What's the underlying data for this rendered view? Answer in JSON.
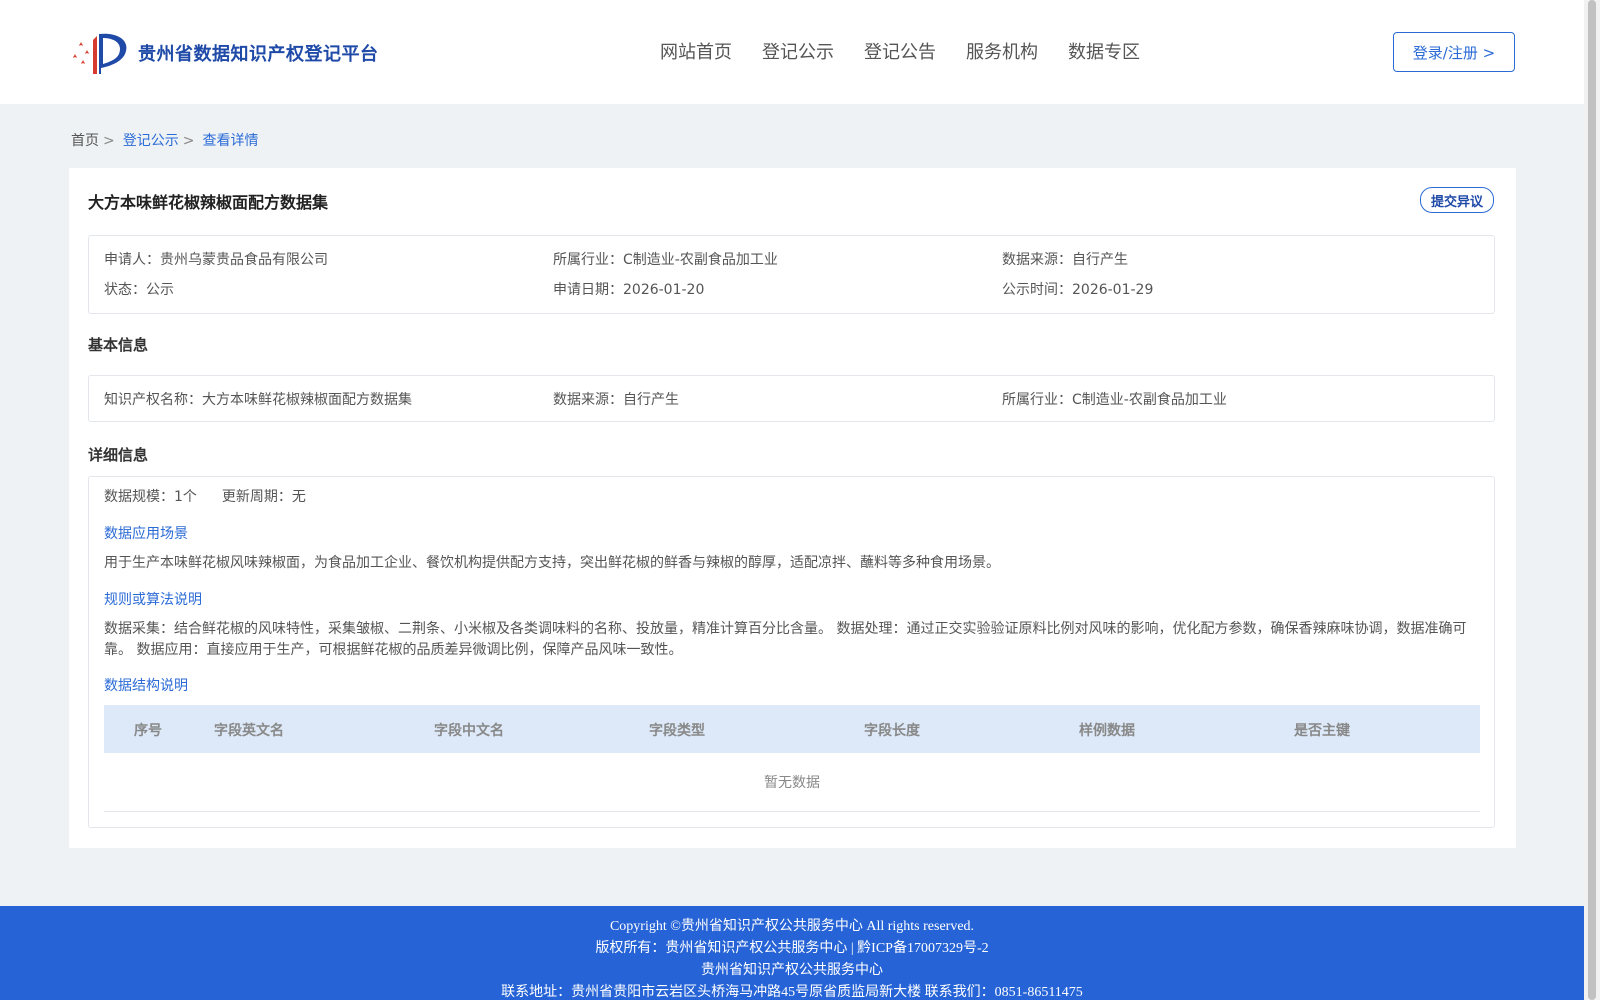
{
  "header": {
    "site_title": "贵州省数据知识产权登记平台",
    "logo_icon": "ip-platform-logo-icon",
    "nav": [
      "网站首页",
      "登记公示",
      "登记公告",
      "服务机构",
      "数据专区"
    ],
    "login_label": "登录/注册 >"
  },
  "breadcrumb": {
    "home": "首页",
    "sep": ">",
    "level2": "登记公示",
    "current": "查看详情"
  },
  "detail": {
    "title": "大方本味鲜花椒辣椒面配方数据集",
    "objection_label": "提交异议",
    "summary": {
      "applicant_label": "申请人：",
      "applicant": "贵州乌蒙贵品食品有限公司",
      "industry_label": "所属行业：",
      "industry": "C制造业-农副食品加工业",
      "source_label": "数据来源：",
      "source": "自行产生",
      "status_label": "状态：",
      "status": "公示",
      "apply_date_label": "申请日期：",
      "apply_date": "2026-01-20",
      "publish_time_label": "公示时间：",
      "publish_time": "2026-01-29"
    },
    "basic_title": "基本信息",
    "basic": {
      "ip_name_label": "知识产权名称：",
      "ip_name": "大方本味鲜花椒辣椒面配方数据集",
      "source_label": "数据来源：",
      "source": "自行产生",
      "industry_label": "所属行业：",
      "industry": "C制造业-农副食品加工业"
    },
    "detail_title": "详细信息",
    "scale_label": "数据规模：",
    "scale": "1个",
    "update_label": "更新周期：",
    "update": "无",
    "scene_title": "数据应用场景",
    "scene_text": "用于生产本味鲜花椒风味辣椒面，为食品加工企业、餐饮机构提供配方支持，突出鲜花椒的鲜香与辣椒的醇厚，适配凉拌、蘸料等多种食用场景。",
    "rule_title": "规则或算法说明",
    "rule_text": "数据采集：结合鲜花椒的风味特性，采集皱椒、二荆条、小米椒及各类调味料的名称、投放量，精准计算百分比含量。 数据处理：通过正交实验验证原料比例对风味的影响，优化配方参数，确保香辣麻味协调，数据准确可靠。 数据应用：直接应用于生产，可根据鲜花椒的品质差异微调比例，保障产品风味一致性。",
    "structure_title": "数据结构说明",
    "table_headers": [
      "序号",
      "字段英文名",
      "字段中文名",
      "字段类型",
      "字段长度",
      "样例数据",
      "是否主键"
    ],
    "empty_text": "暂无数据"
  },
  "footer": {
    "line1": "Copyright ©贵州省知识产权公共服务中心 All rights reserved.",
    "line2": "版权所有：贵州省知识产权公共服务中心 | 黔ICP备17007329号-2",
    "line3": "贵州省知识产权公共服务中心",
    "line4": "联系地址：贵州省贵阳市云岩区头桥海马冲路45号原省质监局新大楼 联系我们：0851-86511475"
  },
  "colors": {
    "accent": "#2b6bd6",
    "title_blue": "#1f4aa8",
    "footer_bg": "#2563d6",
    "page_bg": "#eef2f5",
    "table_head_bg": "#dde9f8"
  }
}
